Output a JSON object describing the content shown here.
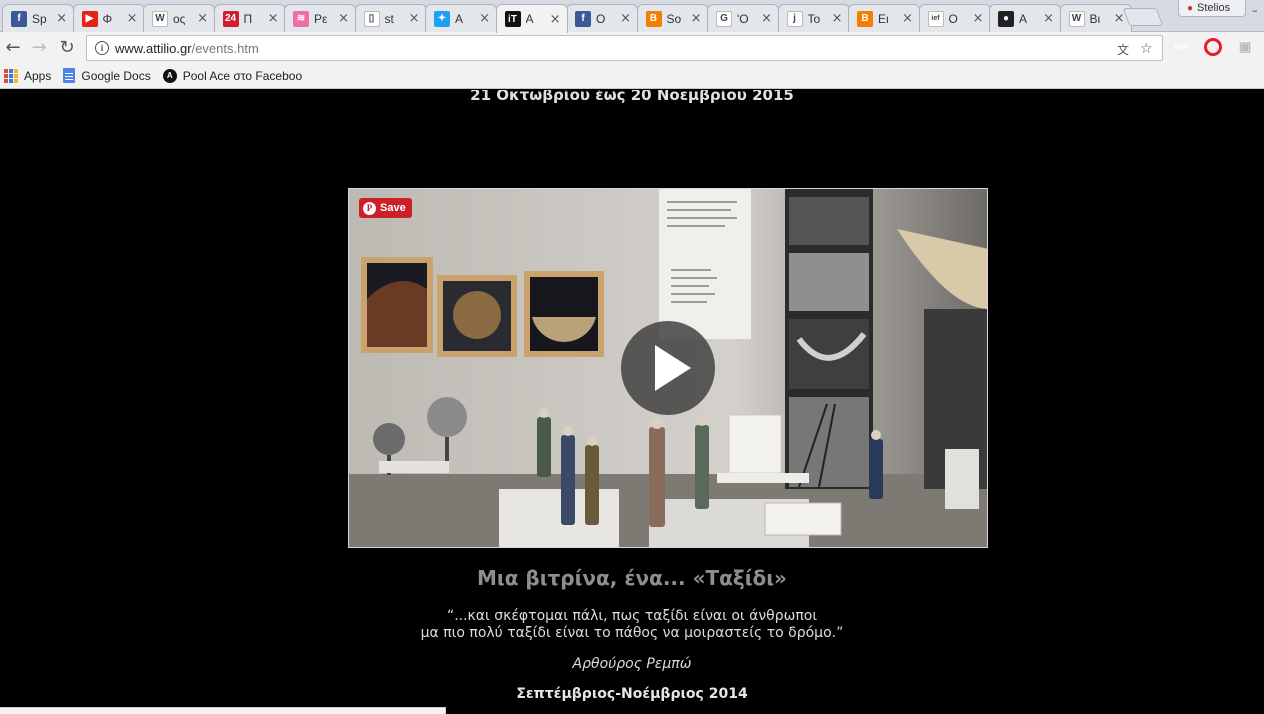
{
  "browser": {
    "tabs": [
      {
        "title": "Sp",
        "icon": "facebook-icon",
        "color": "#3b5998",
        "glyph": "f"
      },
      {
        "title": "Φ",
        "icon": "youtube-icon",
        "color": "#e62117",
        "glyph": "▶"
      },
      {
        "title": "ος",
        "icon": "wikipedia-icon",
        "color": "#ffffff",
        "glyph": "W"
      },
      {
        "title": "Π",
        "icon": "news24-icon",
        "color": "#d21d2e",
        "glyph": "24"
      },
      {
        "title": "Pε",
        "icon": "feed-icon",
        "color": "#ef6ea5",
        "glyph": "≋"
      },
      {
        "title": "st",
        "icon": "document-icon",
        "color": "#ffffff",
        "glyph": "▯"
      },
      {
        "title": "A",
        "icon": "twitter-icon",
        "color": "#1da1f2",
        "glyph": "✦"
      },
      {
        "title": "A",
        "icon": "attilio-icon",
        "color": "#111111",
        "glyph": "iT",
        "active": true
      },
      {
        "title": "O",
        "icon": "facebook-icon",
        "color": "#3b5998",
        "glyph": "f"
      },
      {
        "title": "So",
        "icon": "blogger-icon",
        "color": "#f57d00",
        "glyph": "B"
      },
      {
        "title": "'O",
        "icon": "google-icon",
        "color": "#ffffff",
        "glyph": "G"
      },
      {
        "title": "To",
        "icon": "j-icon",
        "color": "#ffffff",
        "glyph": "j"
      },
      {
        "title": "Eι",
        "icon": "blogger-icon",
        "color": "#f57d00",
        "glyph": "B"
      },
      {
        "title": "O",
        "icon": "ief-icon",
        "color": "#ffffff",
        "glyph": "ief"
      },
      {
        "title": "A",
        "icon": "ball-icon",
        "color": "#222222",
        "glyph": "●"
      },
      {
        "title": "Bι",
        "icon": "wikipedia-icon",
        "color": "#ffffff",
        "glyph": "W"
      }
    ],
    "close_glyph": "×",
    "profile_name": "Stelios",
    "url_host": "www.attilio.gr",
    "url_path": "/events.htm",
    "extensions": [
      {
        "name": "adblock-plus-icon",
        "label": "ABP",
        "color": "#c4161c"
      },
      {
        "name": "opera-icon",
        "label": "O",
        "color": "#e81c2a"
      }
    ]
  },
  "bookmarks": [
    {
      "name": "bookmark-apps",
      "label": "Apps"
    },
    {
      "name": "bookmark-google-docs",
      "label": "Google Docs"
    },
    {
      "name": "bookmark-pool-ace",
      "label": "Pool Ace στο Faceboo"
    }
  ],
  "page": {
    "top_date": "21 Οκτωβρίου έως 20 Νοεμβρίου 2015",
    "save_label": "Save",
    "heading": "Μια βιτρίνα, ένα... «Ταξίδι»",
    "quote_line1": "“...και σκέφτομαι πάλι, πως ταξίδι είναι οι άνθρωποι",
    "quote_line2": "μα πιο πολύ ταξίδι είναι το πάθος να μοιραστείς το δρόμο.”",
    "author": "Αρθούρος Ρεμπώ",
    "bottom_date": "Σεπτέμβριος-Νοέμβριος 2014"
  }
}
